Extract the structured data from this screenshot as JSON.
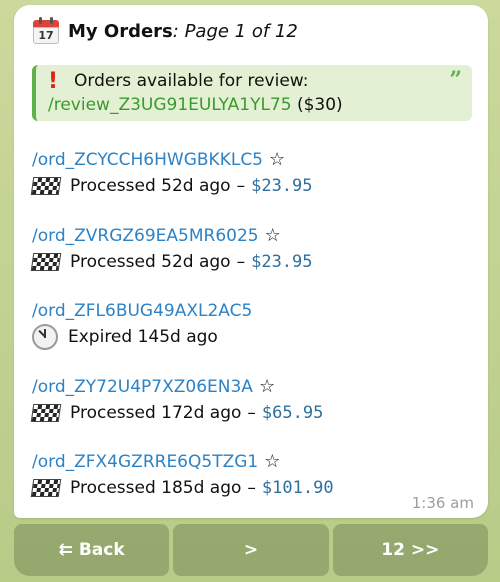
{
  "header": {
    "title": "My Orders",
    "subtitle": ": Page 1 of 12",
    "calendar_day": "17"
  },
  "review": {
    "text": "Orders available for review:",
    "command": "/review_Z3UG91EULYA1YL75",
    "amount": " ($30)"
  },
  "orders": [
    {
      "id": "/ord_ZCYCCH6HWGBKKLC5",
      "star": "☆",
      "status_icon": "checkered-flag-icon",
      "status": "Processed 52d ago",
      "dash": "–",
      "price": "$23.95"
    },
    {
      "id": "/ord_ZVRGZ69EA5MR6025",
      "star": "☆",
      "status_icon": "checkered-flag-icon",
      "status": "Processed 52d ago",
      "dash": "–",
      "price": "$23.95"
    },
    {
      "id": "/ord_ZFL6BUG49AXL2AC5",
      "star": "",
      "status_icon": "clock-icon",
      "status": "Expired 145d ago",
      "dash": "",
      "price": ""
    },
    {
      "id": "/ord_ZY72U4P7XZ06EN3A",
      "star": "☆",
      "status_icon": "checkered-flag-icon",
      "status": "Processed 172d ago",
      "dash": "–",
      "price": "$65.95"
    },
    {
      "id": "/ord_ZFX4GZRRE6Q5TZG1",
      "star": "☆",
      "status_icon": "checkered-flag-icon",
      "status": "Processed 185d ago",
      "dash": "–",
      "price": "$101.90"
    }
  ],
  "message_time": "1:36 am",
  "keyboard": {
    "back": "⇇ Back",
    "next": ">",
    "last": "12 >>"
  },
  "colors": {
    "link": "#2d82c5",
    "review_accent": "#5fb14a",
    "price": "#2f6f9e"
  }
}
